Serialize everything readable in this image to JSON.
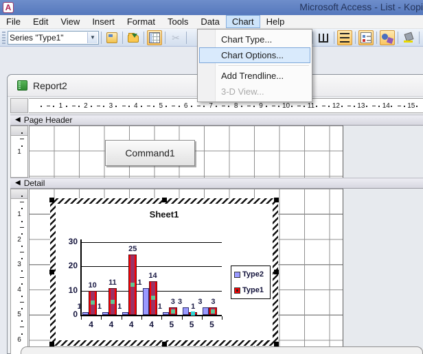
{
  "window": {
    "title_bar": "Microsoft Access - List - Kopi",
    "app_icon_letter": "A"
  },
  "menubar": {
    "items": [
      "File",
      "Edit",
      "View",
      "Insert",
      "Format",
      "Tools",
      "Data",
      "Chart",
      "Help"
    ],
    "active_item": "Chart"
  },
  "toolbar": {
    "series_combo_value": "Series \"Type1\"",
    "left_buttons": [
      {
        "name": "format-object-button",
        "icon": "format-icon",
        "toggled": false,
        "disabled": false
      },
      {
        "name": "import-file-button",
        "icon": "import-file-icon",
        "toggled": false,
        "disabled": false
      },
      {
        "name": "view-datasheet-button",
        "icon": "datasheet-icon",
        "toggled": true,
        "disabled": false
      },
      {
        "name": "cut-button",
        "icon": "cut-icon",
        "glyph": "✂",
        "toggled": false,
        "disabled": true
      }
    ],
    "right_buttons": [
      {
        "name": "chart-type-button",
        "icon": "chart-type-icon",
        "toggled": false,
        "disabled": false,
        "has_caret": true
      },
      {
        "name": "category-axis-gridlines-button",
        "icon": "category-gridlines-icon",
        "toggled": false,
        "disabled": false
      },
      {
        "name": "value-axis-gridlines-button",
        "icon": "value-gridlines-icon",
        "toggled": true,
        "disabled": false
      },
      {
        "name": "legend-button",
        "icon": "legend-icon",
        "toggled": true,
        "disabled": false
      },
      {
        "name": "drawing-button",
        "icon": "drawing-icon",
        "toggled": true,
        "disabled": false
      },
      {
        "name": "fill-color-button",
        "icon": "fill-color-icon",
        "toggled": false,
        "disabled": false
      }
    ]
  },
  "chart_menu": {
    "items": [
      {
        "label": "Chart Type...",
        "state": "normal"
      },
      {
        "label": "Chart Options...",
        "state": "highlighted"
      },
      {
        "label": "",
        "state": "separator"
      },
      {
        "label": "Add Trendline...",
        "state": "normal"
      },
      {
        "label": "3-D View...",
        "state": "disabled"
      }
    ]
  },
  "report": {
    "doc_title": "Report2",
    "page_header_label": "Page Header",
    "detail_label": "Detail",
    "command_button_label": "Command1",
    "h_ruler_numbers": [
      1,
      2,
      3,
      4,
      5,
      6,
      7,
      8,
      9,
      10,
      11,
      12,
      13,
      14,
      15
    ],
    "page_header_ruler_numbers": [
      1
    ],
    "detail_ruler_numbers": [
      1,
      2,
      3,
      4,
      5,
      6
    ]
  },
  "chart_data": {
    "type": "bar",
    "title": "Sheet1",
    "categories": [
      "4",
      "4",
      "4",
      "4",
      "5",
      "5",
      "5"
    ],
    "series": [
      {
        "name": "Type2",
        "color": "#9999FF",
        "values": [
          1,
          1,
          1,
          11,
          1,
          3,
          3
        ]
      },
      {
        "name": "Type1",
        "color": "#FF0000",
        "values": [
          10,
          11,
          25,
          14,
          3,
          1,
          3
        ]
      }
    ],
    "ylim": [
      0,
      30
    ],
    "yticks": [
      0,
      10,
      20,
      30
    ],
    "grid": true,
    "data_labels": true,
    "legend_position": "right",
    "selection": {
      "selected_series": "Type1",
      "handle_colors": [
        "#5ec897",
        "#5ec897",
        "#5ec897",
        "#5ec897",
        "#5ec897",
        "#2fd6d6",
        "#5ec897"
      ]
    }
  }
}
